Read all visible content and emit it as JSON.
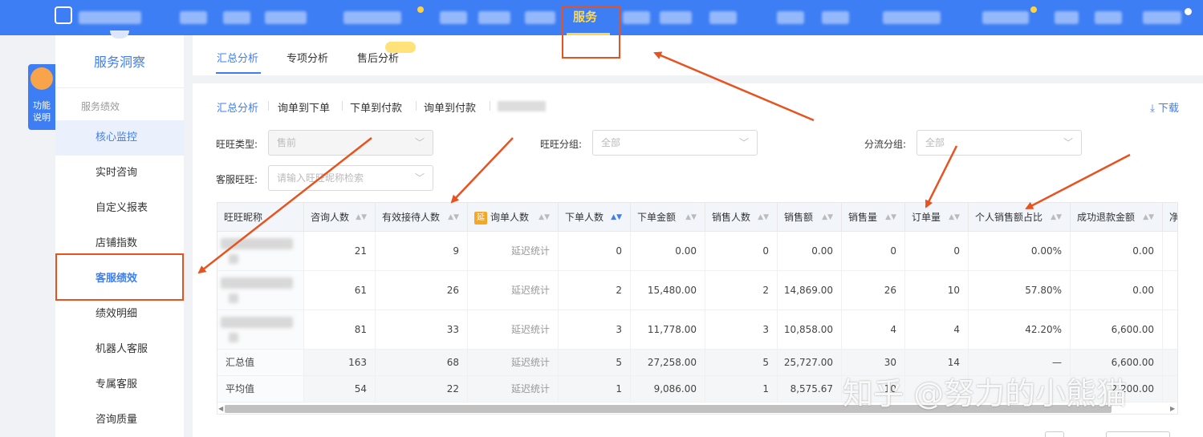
{
  "topnav": {
    "active_label": "服务"
  },
  "sidebar": {
    "title": "服务洞察",
    "section": "服务绩效",
    "items": [
      {
        "label": "核心监控"
      },
      {
        "label": "实时咨询"
      },
      {
        "label": "自定义报表"
      },
      {
        "label": "店铺指数"
      },
      {
        "label": "客服绩效"
      },
      {
        "label": "绩效明细"
      },
      {
        "label": "机器人客服"
      },
      {
        "label": "专属客服"
      },
      {
        "label": "咨询质量"
      }
    ]
  },
  "helper": {
    "label_line1": "功能",
    "label_line2": "说明"
  },
  "tabs": [
    "汇总分析",
    "专项分析",
    "售后分析"
  ],
  "subtabs": [
    "汇总分析",
    "询单到下单",
    "下单到付款",
    "询单到付款",
    ""
  ],
  "download_label": "下载",
  "filters": {
    "wangwang_type_label": "旺旺类型:",
    "wangwang_type_value": "售前",
    "wangwang_group_label": "旺旺分组:",
    "wangwang_group_value": "全部",
    "flow_group_label": "分流分组:",
    "flow_group_value": "全部",
    "cs_label": "客服旺旺:",
    "cs_placeholder": "请输入旺旺昵称检索"
  },
  "table": {
    "yan_badge": "延",
    "columns": [
      "旺旺昵称",
      "咨询人数",
      "有效接待人数",
      "询单人数",
      "下单人数",
      "下单金额",
      "销售人数",
      "销售额",
      "销售量",
      "订单量",
      "个人销售额占比",
      "成功退款金额",
      "净"
    ],
    "rows": [
      [
        "",
        "21",
        "9",
        "延迟统计",
        "0",
        "0.00",
        "0",
        "0.00",
        "0",
        "0",
        "0.00%",
        "0.00"
      ],
      [
        "",
        "61",
        "26",
        "延迟统计",
        "2",
        "15,480.00",
        "2",
        "14,869.00",
        "26",
        "10",
        "57.80%",
        "0.00"
      ],
      [
        "",
        "81",
        "33",
        "延迟统计",
        "3",
        "11,778.00",
        "3",
        "10,858.00",
        "4",
        "4",
        "42.20%",
        "6,600.00"
      ]
    ],
    "summary_rows": [
      [
        "汇总值",
        "163",
        "68",
        "延迟统计",
        "5",
        "27,258.00",
        "5",
        "25,727.00",
        "30",
        "14",
        "—",
        "6,600.00"
      ],
      [
        "平均值",
        "54",
        "22",
        "延迟统计",
        "1",
        "9,086.00",
        "1",
        "8,575.67",
        "10",
        "",
        "",
        "2,200.00"
      ]
    ]
  },
  "watermark": "知乎 @努力的小熊猫",
  "colors": {
    "brand": "#3d7ef5",
    "annotation": "#e8521f",
    "highlight": "#ffd84d"
  }
}
